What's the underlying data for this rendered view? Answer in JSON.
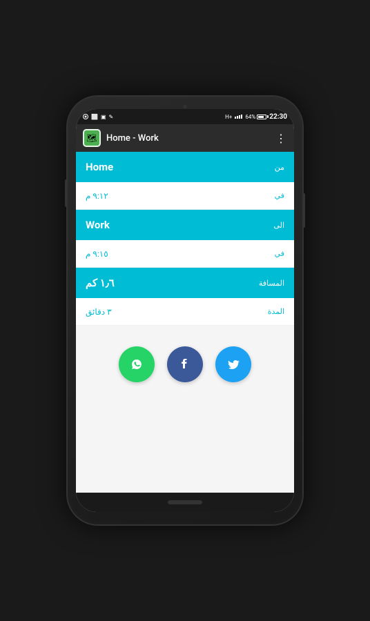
{
  "status_bar": {
    "time": "22:30",
    "battery_pct": "64%",
    "signal_label": "H+"
  },
  "toolbar": {
    "title": "Home - Work",
    "menu_dots": "⋮"
  },
  "rows": [
    {
      "type": "teal",
      "label": "من",
      "value": "Home",
      "label_side": "right",
      "value_side": "left"
    },
    {
      "type": "white_teal",
      "label": "في",
      "value": "٩:١٢ م"
    },
    {
      "type": "teal",
      "label": "الى",
      "value": "Work",
      "label_side": "right",
      "value_side": "left"
    },
    {
      "type": "white_teal",
      "label": "في",
      "value": "٩:١٥ م"
    },
    {
      "type": "teal",
      "label": "المسافة",
      "value": "١٫٦ كم"
    },
    {
      "type": "white_teal",
      "label": "المدة",
      "value": "٣ دقائق"
    }
  ],
  "share": {
    "whatsapp_icon": "W",
    "facebook_icon": "f",
    "twitter_icon": "t"
  }
}
